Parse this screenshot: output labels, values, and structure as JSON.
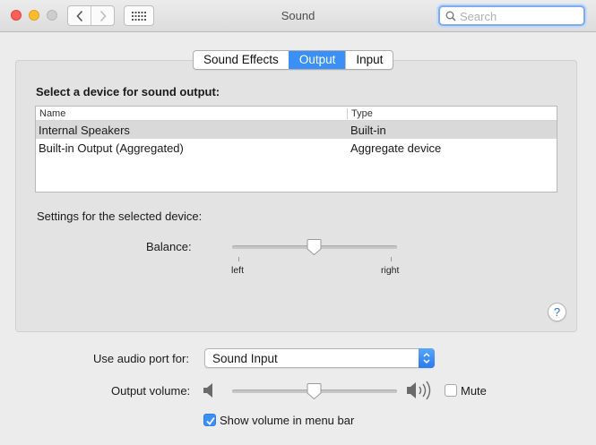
{
  "window": {
    "title": "Sound",
    "search_placeholder": "Search",
    "controls": [
      "close",
      "minimize",
      "zoom"
    ],
    "icons": {
      "back": "chevron-left-icon",
      "forward": "chevron-right-icon",
      "show_all": "grid-icon",
      "search": "search-icon"
    }
  },
  "tabs": [
    {
      "label": "Sound Effects",
      "active": false
    },
    {
      "label": "Output",
      "active": true
    },
    {
      "label": "Input",
      "active": false
    }
  ],
  "output": {
    "heading": "Select a device for sound output:",
    "columns": [
      "Name",
      "Type"
    ],
    "devices": [
      {
        "name": "Internal Speakers",
        "type": "Built-in",
        "selected": true
      },
      {
        "name": "Built-in Output (Aggregated)",
        "type": "Aggregate device",
        "selected": false
      }
    ],
    "settings_heading": "Settings for the selected device:",
    "balance": {
      "label": "Balance:",
      "min_label": "left",
      "max_label": "right",
      "value": 0.5
    },
    "help_label": "?"
  },
  "bottom": {
    "audio_port": {
      "label": "Use audio port for:",
      "value": "Sound Input"
    },
    "volume": {
      "label": "Output volume:",
      "value": 0.5,
      "icons": {
        "low": "speaker-low-icon",
        "high": "speaker-high-icon"
      }
    },
    "mute": {
      "label": "Mute",
      "checked": false
    },
    "show_in_menu_bar": {
      "label": "Show volume in menu bar",
      "checked": true
    }
  },
  "colors": {
    "accent": "#3b90f7",
    "window_background": "#ececec",
    "panel_background": "#e3e3e3",
    "selected_row": "#d9d9d9"
  }
}
